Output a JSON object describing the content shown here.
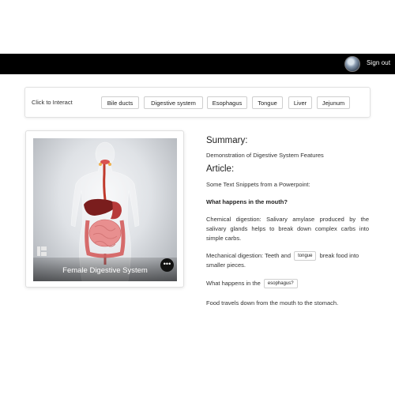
{
  "header": {
    "signout_label": "Sign out"
  },
  "interact": {
    "label": "Click to Interact",
    "chips": [
      "Bile ducts",
      "Digestive system",
      "Esophagus",
      "Tongue",
      "Liver",
      "Jejunum"
    ]
  },
  "model_card": {
    "caption": "Female Digestive System",
    "more_label": "•••"
  },
  "content": {
    "summary_heading": "Summary:",
    "summary_text": "Demonstration of Digestive System Features",
    "article_heading": "Article:",
    "intro": "Some Text Snippets from a Powerpoint:",
    "q1": "What happens in the mouth?",
    "p1": "Chemical digestion: Salivary amylase produced by the salivary glands helps to break down complex carbs into simple carbs.",
    "p2_pre": "Mechanical digestion: Teeth and",
    "p2_chip": "tongue",
    "p2_post": "break food into",
    "p2_line2": "smaller pieces.",
    "q2_pre": "What happens in the",
    "q2_chip": "esophagus?",
    "p3": "Food travels down from the mouth to the stomach."
  }
}
